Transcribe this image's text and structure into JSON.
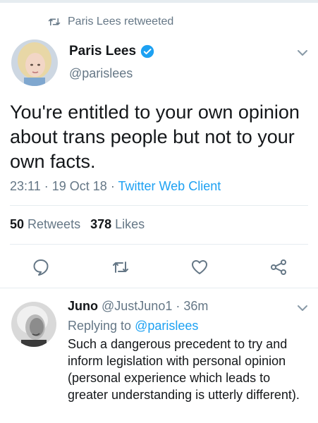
{
  "retweet_banner": {
    "text": "Paris Lees retweeted"
  },
  "tweet": {
    "author_name": "Paris Lees",
    "author_handle": "@parislees",
    "text": "You're entitled to your own opinion about trans people but not to your own facts.",
    "time": "23:11",
    "date": "19 Oct 18",
    "separator": "·",
    "client": "Twitter Web Client",
    "retweets_count": "50",
    "retweets_label": "Retweets",
    "likes_count": "378",
    "likes_label": "Likes"
  },
  "icons": {
    "retweet_banner": "retweet-icon",
    "verified": "verified-badge-icon",
    "menu": "chevron-down-icon",
    "reply": "reply-icon",
    "retweet": "retweet-icon",
    "like": "heart-icon",
    "share": "share-icon"
  },
  "reply": {
    "author_name": "Juno",
    "author_handle": "@JustJuno1",
    "separator": "·",
    "time_ago": "36m",
    "replying_to_label": "Replying to",
    "replying_to_handle": "@parislees",
    "text": "Such a dangerous precedent to try and inform legislation with personal opinion (personal experience which leads to greater understanding is utterly different)."
  },
  "colors": {
    "link": "#1da1f2",
    "muted": "#657786",
    "text": "#14171a",
    "divider": "#e6ecf0"
  }
}
